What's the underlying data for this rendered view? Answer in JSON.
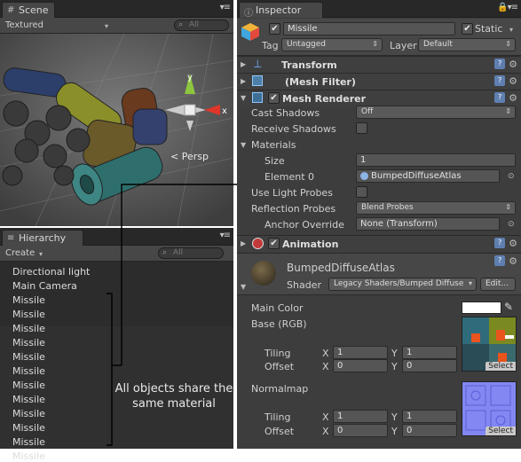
{
  "scene": {
    "tab_label": "Scene",
    "tab_icon": "#",
    "mode_label": "Textured",
    "search_placeholder": "All",
    "persp_label": "Persp",
    "gizmo": {
      "y_label": "y",
      "x_label": "x"
    }
  },
  "hierarchy": {
    "tab_label": "Hierarchy",
    "tab_icon": "≡",
    "create_label": "Create",
    "search_placeholder": "All",
    "items": [
      "Directional light",
      "Main Camera",
      "Missile",
      "Missile",
      "Missile",
      "Missile",
      "Missile",
      "Missile",
      "Missile",
      "Missile",
      "Missile",
      "Missile",
      "Missile",
      "Missile"
    ]
  },
  "annotation": "All objects share the same material",
  "inspector": {
    "tab_label": "Inspector",
    "tab_icon": "ⓘ",
    "object_name": "Missile",
    "active_check": "✔",
    "static_check": "✔",
    "static_label": "Static",
    "tag_label": "Tag",
    "tag_value": "Untagged",
    "layer_label": "Layer",
    "layer_value": "Default",
    "components": {
      "transform": "Transform",
      "mesh_filter": "(Mesh Filter)",
      "mesh_renderer": "Mesh Renderer",
      "animation": "Animation"
    },
    "mesh_renderer": {
      "cast_shadows_label": "Cast Shadows",
      "cast_shadows_value": "Off",
      "receive_shadows_label": "Receive Shadows",
      "materials_label": "Materials",
      "size_label": "Size",
      "size_value": "1",
      "element0_label": "Element 0",
      "element0_value": "BumpedDiffuseAtlas",
      "light_probes_label": "Use Light Probes",
      "reflection_probes_label": "Reflection Probes",
      "reflection_probes_value": "Blend Probes",
      "anchor_label": "Anchor Override",
      "anchor_value": "None (Transform)"
    },
    "material": {
      "name": "BumpedDiffuseAtlas",
      "shader_label": "Shader",
      "shader_value": "Legacy Shaders/Bumped Diffuse",
      "edit_label": "Edit...",
      "main_color_label": "Main Color",
      "base_label": "Base (RGB)",
      "normalmap_label": "Normalmap",
      "tiling_label": "Tiling",
      "offset_label": "Offset",
      "x_label": "X",
      "y_label": "Y",
      "base_tiling": [
        "1",
        "1"
      ],
      "base_offset": [
        "0",
        "0"
      ],
      "normal_tiling": [
        "1",
        "1"
      ],
      "normal_offset": [
        "0",
        "0"
      ],
      "select_label": "Select"
    }
  }
}
